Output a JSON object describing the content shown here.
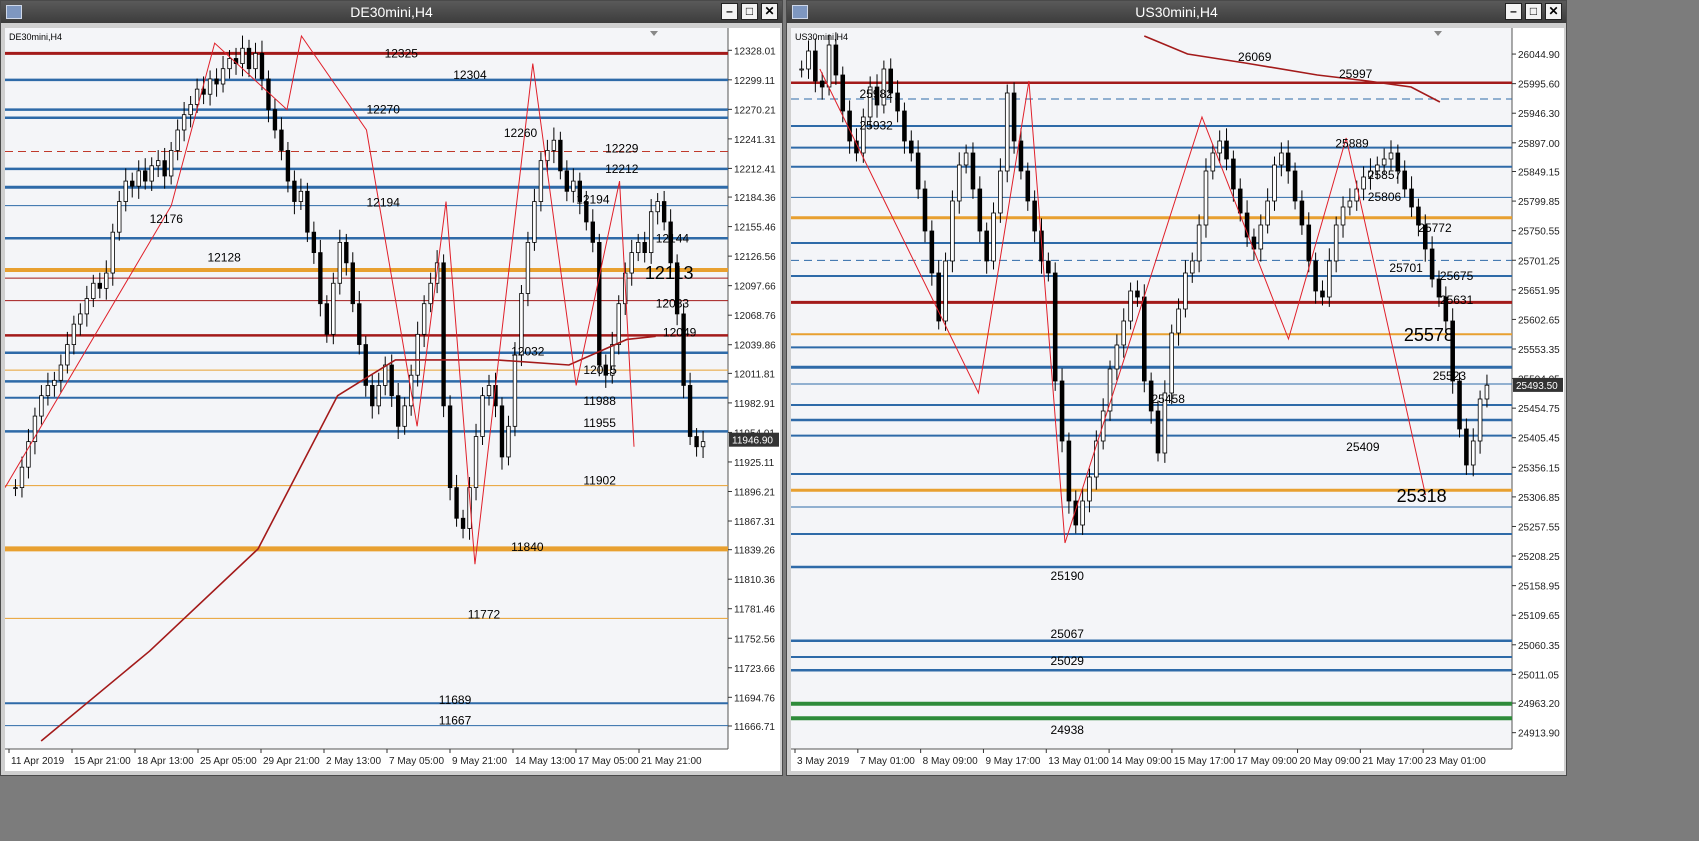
{
  "windows": [
    {
      "title": "DE30mini,H4",
      "symbol_label": "DE30mini,H4",
      "current_price": "11946.90",
      "chart_data": {
        "type": "candlestick",
        "ylim": [
          11652,
          12342
        ],
        "y_ticks": [
          "12328.01",
          "12299.11",
          "12270.21",
          "12241.31",
          "12212.41",
          "12184.36",
          "12155.46",
          "12126.56",
          "12097.66",
          "12068.76",
          "12039.86",
          "12011.81",
          "11982.91",
          "11954.01",
          "11925.11",
          "11896.21",
          "11867.31",
          "11839.26",
          "11810.36",
          "11781.46",
          "11752.56",
          "11723.66",
          "11694.76",
          "11666.71"
        ],
        "x_ticks": [
          "11 Apr 2019",
          "15 Apr 21:00",
          "18 Apr 13:00",
          "25 Apr 05:00",
          "29 Apr 21:00",
          "2 May 13:00",
          "7 May 05:00",
          "9 May 21:00",
          "14 May 13:00",
          "17 May 05:00",
          "21 May 21:00"
        ],
        "levels": [
          {
            "value": 12325,
            "color": "#a31a1a",
            "width": 3
          },
          {
            "value": 12299,
            "color": "#2e6aa8",
            "width": 2.5
          },
          {
            "value": 12270,
            "color": "#2e6aa8",
            "width": 2.5
          },
          {
            "value": 12262,
            "color": "#2e6aa8",
            "width": 2.5
          },
          {
            "value": 12229,
            "color": "#c0392b",
            "width": 1,
            "dash": true
          },
          {
            "value": 12212,
            "color": "#2e6aa8",
            "width": 2.5
          },
          {
            "value": 12194,
            "color": "#2e6aa8",
            "width": 3
          },
          {
            "value": 12176,
            "color": "#2e6aa8",
            "width": 1
          },
          {
            "value": 12144,
            "color": "#2e6aa8",
            "width": 2.5
          },
          {
            "value": 12113,
            "color": "#e8a030",
            "width": 4
          },
          {
            "value": 12105,
            "color": "#a31a1a",
            "width": 1
          },
          {
            "value": 12083,
            "color": "#a31a1a",
            "width": 1
          },
          {
            "value": 12049,
            "color": "#a31a1a",
            "width": 2.5
          },
          {
            "value": 12032,
            "color": "#2e6aa8",
            "width": 2.5
          },
          {
            "value": 12015,
            "color": "#e8a030",
            "width": 1
          },
          {
            "value": 12004,
            "color": "#2e6aa8",
            "width": 2.5
          },
          {
            "value": 11988,
            "color": "#2e6aa8",
            "width": 2
          },
          {
            "value": 11955,
            "color": "#2e6aa8",
            "width": 2.5
          },
          {
            "value": 11902,
            "color": "#e8a030",
            "width": 1
          },
          {
            "value": 11840,
            "color": "#e8a030",
            "width": 5
          },
          {
            "value": 11772,
            "color": "#e8a030",
            "width": 1
          },
          {
            "value": 11689,
            "color": "#2e6aa8",
            "width": 2
          },
          {
            "value": 11667,
            "color": "#2e6aa8",
            "width": 1
          }
        ],
        "level_labels": [
          {
            "text": "12325",
            "x": 0.525,
            "value": 12325
          },
          {
            "text": "12304",
            "x": 0.62,
            "value": 12304
          },
          {
            "text": "12270",
            "x": 0.5,
            "value": 12270
          },
          {
            "text": "12260",
            "x": 0.69,
            "value": 12247
          },
          {
            "text": "12229",
            "x": 0.83,
            "value": 12232
          },
          {
            "text": "12212",
            "x": 0.83,
            "value": 12212
          },
          {
            "text": "12194",
            "x": 0.5,
            "value": 12179
          },
          {
            "text": "12194",
            "x": 0.79,
            "value": 12182
          },
          {
            "text": "12176",
            "x": 0.2,
            "value": 12163
          },
          {
            "text": "12144",
            "x": 0.9,
            "value": 12144
          },
          {
            "text": "12128",
            "x": 0.28,
            "value": 12125
          },
          {
            "text": "12113",
            "x": 0.885,
            "value": 12108,
            "big": true
          },
          {
            "text": "12083",
            "x": 0.9,
            "value": 12080
          },
          {
            "text": "12049",
            "x": 0.91,
            "value": 12052
          },
          {
            "text": "12032",
            "x": 0.7,
            "value": 12033
          },
          {
            "text": "12015",
            "x": 0.8,
            "value": 12015
          },
          {
            "text": "11988",
            "x": 0.8,
            "value": 11985
          },
          {
            "text": "11955",
            "x": 0.8,
            "value": 11963
          },
          {
            "text": "11902",
            "x": 0.8,
            "value": 11907
          },
          {
            "text": "11840",
            "x": 0.7,
            "value": 11842
          },
          {
            "text": "11772",
            "x": 0.64,
            "value": 11776
          },
          {
            "text": "11689",
            "x": 0.6,
            "value": 11692
          },
          {
            "text": "11667",
            "x": 0.6,
            "value": 11672
          }
        ],
        "close": [
          11900,
          11920,
          11945,
          11970,
          11990,
          12000,
          12005,
          12020,
          12040,
          12060,
          12070,
          12085,
          12100,
          12095,
          12110,
          12150,
          12180,
          12200,
          12195,
          12210,
          12200,
          12215,
          12220,
          12205,
          12230,
          12250,
          12265,
          12275,
          12290,
          12285,
          12300,
          12295,
          12310,
          12320,
          12315,
          12330,
          12310,
          12325,
          12300,
          12270,
          12250,
          12230,
          12200,
          12180,
          12190,
          12150,
          12130,
          12080,
          12050,
          12100,
          12140,
          12120,
          12080,
          12040,
          12000,
          11980,
          12000,
          12020,
          11990,
          11960,
          11980,
          12010,
          12050,
          12080,
          12100,
          12120,
          11980,
          11900,
          11870,
          11860,
          11900,
          11950,
          11990,
          12000,
          11980,
          11930,
          11960,
          12030,
          12090,
          12140,
          12180,
          12220,
          12230,
          12240,
          12210,
          12190,
          12200,
          12180,
          12160,
          12140,
          12020,
          12010,
          12040,
          12080,
          12110,
          12130,
          12140,
          12130,
          12170,
          12180,
          12160,
          12120,
          12070,
          12000,
          11950,
          11940,
          11945
        ],
        "ma": [
          {
            "x": 0.05,
            "v": 11652
          },
          {
            "x": 0.2,
            "v": 11740
          },
          {
            "x": 0.35,
            "v": 11840
          },
          {
            "x": 0.46,
            "v": 11990
          },
          {
            "x": 0.54,
            "v": 12025
          },
          {
            "x": 0.63,
            "v": 12025
          },
          {
            "x": 0.68,
            "v": 12025
          },
          {
            "x": 0.78,
            "v": 12020
          },
          {
            "x": 0.86,
            "v": 12045
          },
          {
            "x": 0.9,
            "v": 12048
          }
        ],
        "zigzag": [
          {
            "x": 0.0,
            "v": 11900
          },
          {
            "x": 0.23,
            "v": 12176
          },
          {
            "x": 0.29,
            "v": 12335
          },
          {
            "x": 0.39,
            "v": 12270
          },
          {
            "x": 0.41,
            "v": 12342
          },
          {
            "x": 0.5,
            "v": 12250
          },
          {
            "x": 0.57,
            "v": 11960
          },
          {
            "x": 0.61,
            "v": 12180
          },
          {
            "x": 0.65,
            "v": 11825
          },
          {
            "x": 0.73,
            "v": 12315
          },
          {
            "x": 0.79,
            "v": 12000
          },
          {
            "x": 0.85,
            "v": 12200
          },
          {
            "x": 0.87,
            "v": 11940
          }
        ]
      }
    },
    {
      "title": "US30mini,H4",
      "symbol_label": "US30mini,H4",
      "current_price": "25493.50",
      "chart_data": {
        "type": "candlestick",
        "ylim": [
          24900,
          26075
        ],
        "y_ticks": [
          "26044.90",
          "25995.60",
          "25946.30",
          "25897.00",
          "25849.15",
          "25799.85",
          "25750.55",
          "25701.25",
          "25651.95",
          "25602.65",
          "25553.35",
          "25504.05",
          "25454.75",
          "25405.45",
          "25356.15",
          "25306.85",
          "25257.55",
          "25208.25",
          "25158.95",
          "25109.65",
          "25060.35",
          "25011.05",
          "24963.20",
          "24913.90"
        ],
        "x_ticks": [
          "3 May 2019",
          "7 May 01:00",
          "8 May 09:00",
          "9 May 17:00",
          "13 May 01:00",
          "14 May 09:00",
          "15 May 17:00",
          "17 May 09:00",
          "20 May 09:00",
          "21 May 17:00",
          "23 May 01:00"
        ],
        "levels": [
          {
            "value": 25997,
            "color": "#a31a1a",
            "width": 2.5
          },
          {
            "value": 25970,
            "color": "#2e6aa8",
            "width": 1,
            "dash": true
          },
          {
            "value": 25925,
            "color": "#2e6aa8",
            "width": 2
          },
          {
            "value": 25889,
            "color": "#2e6aa8",
            "width": 2
          },
          {
            "value": 25857,
            "color": "#2e6aa8",
            "width": 2
          },
          {
            "value": 25806,
            "color": "#2e6aa8",
            "width": 1
          },
          {
            "value": 25772,
            "color": "#e8a030",
            "width": 3
          },
          {
            "value": 25730,
            "color": "#2e6aa8",
            "width": 2
          },
          {
            "value": 25701,
            "color": "#2e6aa8",
            "width": 1,
            "dash": true
          },
          {
            "value": 25675,
            "color": "#2e6aa8",
            "width": 2
          },
          {
            "value": 25631,
            "color": "#a31a1a",
            "width": 3
          },
          {
            "value": 25578,
            "color": "#e8a030",
            "width": 2
          },
          {
            "value": 25556,
            "color": "#2e6aa8",
            "width": 2
          },
          {
            "value": 25523,
            "color": "#2e6aa8",
            "width": 3
          },
          {
            "value": 25495,
            "color": "#2e6aa8",
            "width": 1
          },
          {
            "value": 25460,
            "color": "#2e6aa8",
            "width": 2
          },
          {
            "value": 25435,
            "color": "#2e6aa8",
            "width": 2.5
          },
          {
            "value": 25409,
            "color": "#2e6aa8",
            "width": 2
          },
          {
            "value": 25345,
            "color": "#2e6aa8",
            "width": 2
          },
          {
            "value": 25318,
            "color": "#e8a030",
            "width": 3
          },
          {
            "value": 25290,
            "color": "#2e6aa8",
            "width": 1
          },
          {
            "value": 25245,
            "color": "#2e6aa8",
            "width": 2
          },
          {
            "value": 25190,
            "color": "#2e6aa8",
            "width": 2.5
          },
          {
            "value": 25067,
            "color": "#2e6aa8",
            "width": 2.5
          },
          {
            "value": 25040,
            "color": "#2e6aa8",
            "width": 2
          },
          {
            "value": 25018,
            "color": "#2e6aa8",
            "width": 2.5
          },
          {
            "value": 24962,
            "color": "#2e8b3a",
            "width": 4
          },
          {
            "value": 24938,
            "color": "#2e8b3a",
            "width": 4
          }
        ],
        "level_labels": [
          {
            "text": "26069",
            "x": 0.62,
            "value": 26040
          },
          {
            "text": "25997",
            "x": 0.76,
            "value": 26012
          },
          {
            "text": "25982",
            "x": 0.095,
            "value": 25978
          },
          {
            "text": "25932",
            "x": 0.095,
            "value": 25926
          },
          {
            "text": "25889",
            "x": 0.755,
            "value": 25896
          },
          {
            "text": "25857",
            "x": 0.8,
            "value": 25843
          },
          {
            "text": "25806",
            "x": 0.8,
            "value": 25807
          },
          {
            "text": "25772",
            "x": 0.87,
            "value": 25755
          },
          {
            "text": "25701",
            "x": 0.83,
            "value": 25688
          },
          {
            "text": "25675",
            "x": 0.9,
            "value": 25675
          },
          {
            "text": "25631",
            "x": 0.9,
            "value": 25635
          },
          {
            "text": "25578",
            "x": 0.85,
            "value": 25573,
            "big": true
          },
          {
            "text": "25523",
            "x": 0.89,
            "value": 25508
          },
          {
            "text": "25458",
            "x": 0.5,
            "value": 25470
          },
          {
            "text": "25409",
            "x": 0.77,
            "value": 25390
          },
          {
            "text": "25318",
            "x": 0.84,
            "value": 25305,
            "big": true
          },
          {
            "text": "25190",
            "x": 0.36,
            "value": 25175
          },
          {
            "text": "25067",
            "x": 0.36,
            "value": 25078
          },
          {
            "text": "25029",
            "x": 0.36,
            "value": 25033
          },
          {
            "text": "24938",
            "x": 0.36,
            "value": 24918
          }
        ],
        "close": [
          26020,
          26050,
          26000,
          25990,
          26060,
          26010,
          25950,
          25900,
          25880,
          25940,
          25990,
          25960,
          26020,
          25980,
          25950,
          25900,
          25880,
          25820,
          25750,
          25680,
          25600,
          25700,
          25800,
          25860,
          25880,
          25820,
          25750,
          25700,
          25780,
          25850,
          25980,
          25900,
          25850,
          25800,
          25750,
          25700,
          25680,
          25500,
          25400,
          25300,
          25260,
          25300,
          25340,
          25400,
          25450,
          25520,
          25560,
          25600,
          25650,
          25640,
          25500,
          25450,
          25380,
          25480,
          25580,
          25620,
          25680,
          25700,
          25760,
          25850,
          25880,
          25900,
          25870,
          25820,
          25780,
          25740,
          25720,
          25760,
          25800,
          25860,
          25880,
          25850,
          25800,
          25760,
          25700,
          25650,
          25640,
          25700,
          25760,
          25790,
          25800,
          25820,
          25840,
          25850,
          25860,
          25870,
          25880,
          25850,
          25820,
          25790,
          25760,
          25720,
          25670,
          25640,
          25600,
          25500,
          25420,
          25360,
          25400,
          25470,
          25493
        ],
        "ma": [
          {
            "x": 0.49,
            "v": 26075
          },
          {
            "x": 0.55,
            "v": 26045
          },
          {
            "x": 0.63,
            "v": 26030
          },
          {
            "x": 0.73,
            "v": 26010
          },
          {
            "x": 0.8,
            "v": 26000
          },
          {
            "x": 0.86,
            "v": 25990
          },
          {
            "x": 0.9,
            "v": 25965
          }
        ],
        "zigzag": [
          {
            "x": 0.04,
            "v": 26020
          },
          {
            "x": 0.26,
            "v": 25480
          },
          {
            "x": 0.33,
            "v": 26000
          },
          {
            "x": 0.38,
            "v": 25230
          },
          {
            "x": 0.57,
            "v": 25940
          },
          {
            "x": 0.69,
            "v": 25570
          },
          {
            "x": 0.77,
            "v": 25905
          },
          {
            "x": 0.88,
            "v": 25310
          }
        ]
      }
    }
  ]
}
